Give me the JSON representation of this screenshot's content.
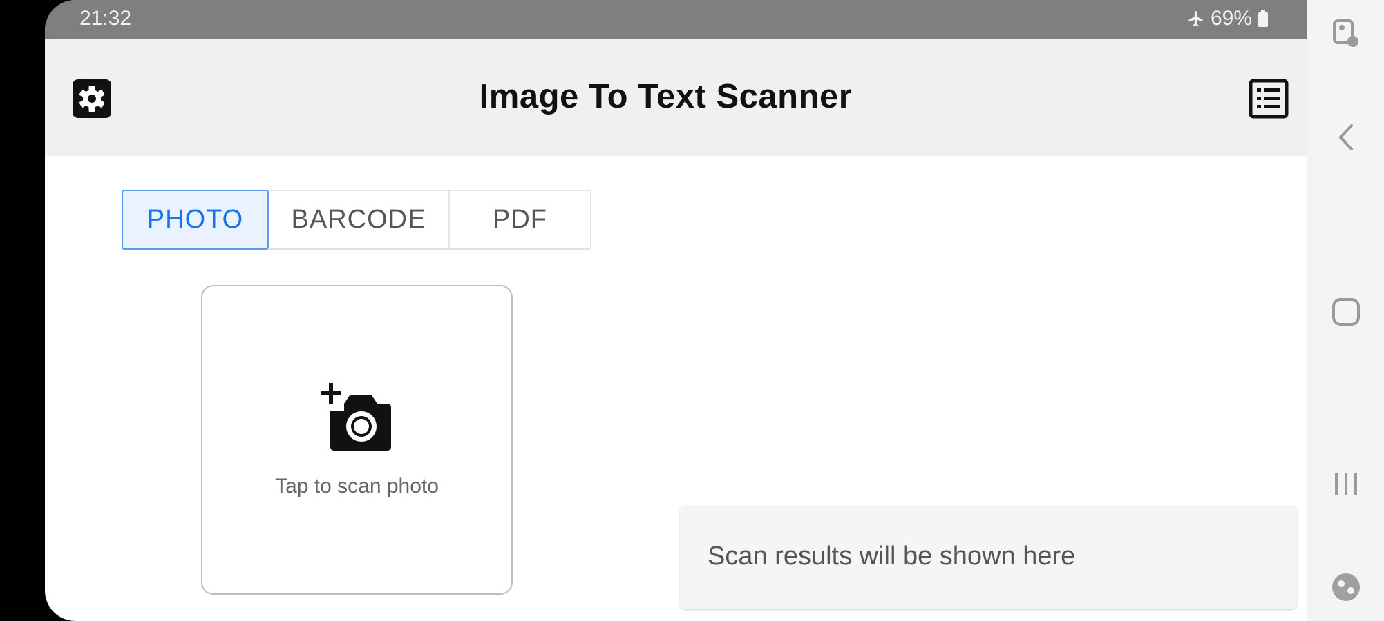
{
  "status_bar": {
    "time": "21:32",
    "battery": "69%",
    "airplane_icon": "airplane-icon",
    "battery_icon": "battery-icon"
  },
  "app_bar": {
    "title": "Image To Text Scanner",
    "left_icon": "gear-icon",
    "right_icon": "list-icon"
  },
  "tabs": [
    {
      "label": "PHOTO",
      "active": true
    },
    {
      "label": "BARCODE",
      "active": false
    },
    {
      "label": "PDF",
      "active": false
    }
  ],
  "scan_card": {
    "icon": "add-camera-icon",
    "label": "Tap to scan photo"
  },
  "results": {
    "placeholder": "Scan results will be shown here"
  },
  "nav_bar": {
    "icons": [
      "screenshot-edit-icon",
      "back-icon",
      "home-icon",
      "recents-icon",
      "assistant-icon"
    ]
  },
  "colors": {
    "accent": "#1a73e8",
    "status_bar": "#7f7f7f",
    "app_bar": "#f0f0f0"
  }
}
